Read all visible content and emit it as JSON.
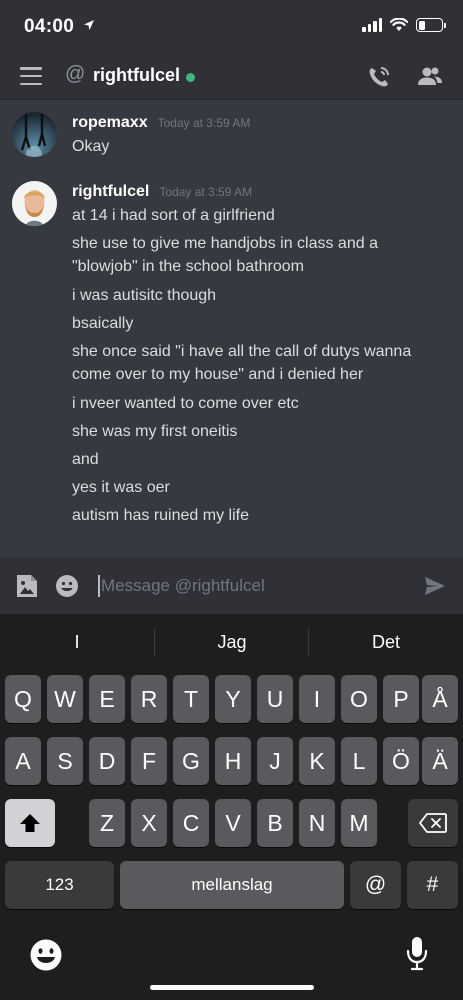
{
  "status_bar": {
    "time": "04:00"
  },
  "header": {
    "at_symbol": "@",
    "title": "rightfulcel",
    "online_color": "#43b581"
  },
  "messages": [
    {
      "username": "ropemaxx",
      "timestamp": "Today at 3:59 AM",
      "lines": [
        "Okay"
      ]
    },
    {
      "username": "rightfulcel",
      "timestamp": "Today at 3:59 AM",
      "lines": [
        "at 14 i had sort of a girlfriend",
        "she use to give me handjobs in class and a \"blowjob\" in the school bathroom",
        "i was autisitc though",
        "bsaically",
        "she once said \"i have all the call of dutys wanna come over to my house\" and i denied her",
        "i nveer wanted to come over etc",
        "she was my first oneitis",
        "and",
        "yes it was oer",
        "autism has ruined my life"
      ]
    }
  ],
  "input": {
    "placeholder": "Message @rightfulcel",
    "value": ""
  },
  "keyboard": {
    "suggestions": [
      "I",
      "Jag",
      "Det"
    ],
    "row1": [
      "Q",
      "W",
      "E",
      "R",
      "T",
      "Y",
      "U",
      "I",
      "O",
      "P",
      "Å"
    ],
    "row2": [
      "A",
      "S",
      "D",
      "F",
      "G",
      "H",
      "J",
      "K",
      "L",
      "Ö",
      "Ä"
    ],
    "row3": [
      "Z",
      "X",
      "C",
      "V",
      "B",
      "N",
      "M"
    ],
    "numbers_label": "123",
    "space_label": "mellanslag",
    "at_label": "@",
    "hash_label": "#"
  },
  "colors": {
    "background": "#36393f",
    "header": "#2f3136",
    "accent": "#43b581"
  }
}
